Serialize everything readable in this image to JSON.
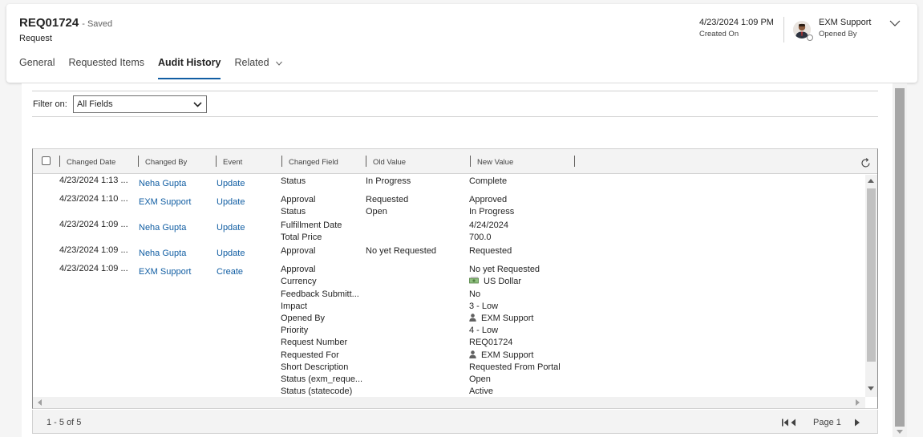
{
  "header": {
    "record_title": "REQ01724",
    "save_status": "- Saved",
    "entity_name": "Request",
    "created_on_value": "4/23/2024 1:09 PM",
    "created_on_label": "Created On",
    "opened_by_value": "EXM Support",
    "opened_by_label": "Opened By"
  },
  "tabs": [
    {
      "label": "General"
    },
    {
      "label": "Requested Items"
    },
    {
      "label": "Audit History"
    },
    {
      "label": "Related"
    }
  ],
  "filter": {
    "label": "Filter on:",
    "selected": "All Fields"
  },
  "grid": {
    "columns": [
      "Changed Date",
      "Changed By",
      "Event",
      "Changed Field",
      "Old Value",
      "New Value"
    ],
    "rows": [
      {
        "date": "4/23/2024 1:13 ...",
        "by": "Neha Gupta",
        "event": "Update",
        "fields": [
          "Status"
        ],
        "old": [
          "In Progress"
        ],
        "new": [
          "Complete"
        ]
      },
      {
        "date": "4/23/2024 1:10 ...",
        "by": "EXM Support",
        "event": "Update",
        "fields": [
          "Approval",
          "Status"
        ],
        "old": [
          "Requested",
          "Open"
        ],
        "new": [
          "Approved",
          "In Progress"
        ]
      },
      {
        "date": "4/23/2024 1:09 ...",
        "by": "Neha Gupta",
        "event": "Update",
        "fields": [
          "Fulfillment Date",
          "Total Price"
        ],
        "old": [
          "",
          ""
        ],
        "new": [
          "4/24/2024",
          "700.0"
        ]
      },
      {
        "date": "4/23/2024 1:09 ...",
        "by": "Neha Gupta",
        "event": "Update",
        "fields": [
          "Approval"
        ],
        "old": [
          "No yet Requested"
        ],
        "new": [
          "Requested"
        ]
      },
      {
        "date": "4/23/2024 1:09 ...",
        "by": "EXM Support",
        "event": "Create",
        "fields": [
          "Approval",
          "Currency",
          "Feedback Submitt...",
          "Impact",
          "Opened By",
          "Priority",
          "Request Number",
          "Requested For",
          "Short Description",
          "Status (exm_reque...",
          "Status (statecode)"
        ],
        "old": [],
        "new": [
          "No yet Requested",
          "US Dollar",
          "No",
          "3 - Low",
          "EXM Support",
          "4 - Low",
          "REQ01724",
          "EXM Support",
          "Requested From Portal",
          "Open",
          "Active"
        ]
      }
    ]
  },
  "footer": {
    "record_count": "1 - 5 of 5",
    "page_label": "Page 1"
  },
  "colors": {
    "link": "#115ea3",
    "active_tab_underline": "#115ea3"
  }
}
